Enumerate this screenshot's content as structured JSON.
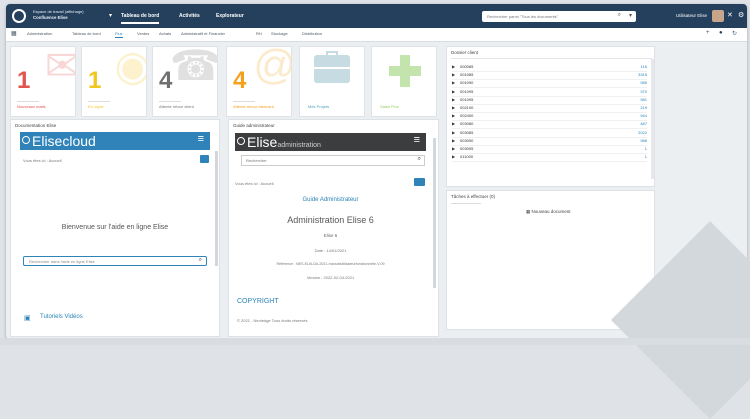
{
  "topbar": {
    "org_line1": "Espace de travail (affichage)",
    "org_line2": "Confluence Elise",
    "tabs": [
      "Tableau de bord",
      "Activités",
      "Explorateur"
    ],
    "search_placeholder": "Rechercher parmi \"Tous les documents\"",
    "user_name": "Utilisateur Elise"
  },
  "subnav": {
    "items": [
      "Administration",
      "Tableau de bord",
      "Flux",
      "Ventes",
      "Achats",
      "Administratif et Financier",
      "RH",
      "Stockage",
      "Distribution"
    ]
  },
  "tiles": [
    {
      "num": "1",
      "label": "Nouveaux mails",
      "color": "#e4524d",
      "icon": "envelope-icon"
    },
    {
      "num": "1",
      "label": "En copie",
      "color": "#f2c51f",
      "icon": "eye-icon"
    },
    {
      "num": "4",
      "label": "Attente retour client",
      "color": "#6f6f6f",
      "icon": "phone-icon"
    },
    {
      "num": "4",
      "label": "Attente retour fabricant",
      "color": "#f4a11c",
      "icon": "at-icon"
    },
    {
      "num": "",
      "label": "Mes Projets",
      "color": "#4ba4c0",
      "icon": "briefcase-icon"
    },
    {
      "num": "",
      "label": "Saisir Flux",
      "color": "#8fcd5b",
      "icon": "plus-icon"
    }
  ],
  "doc_panel": {
    "title": "Documentation Elise",
    "brand": "Elise",
    "brand_suffix": "cloud",
    "path": "Vous êtes ici : Accueil",
    "welcome": "Bienvenue sur l'aide en ligne Elise",
    "search_placeholder": "Rechercher dans l'aide en ligne Elise",
    "tutorial": "Tutoriels Vidéos"
  },
  "admin_panel": {
    "title": "Guide administrateur",
    "brand": "Elise",
    "brand_suffix": "administration",
    "search_placeholder": "Rechercher",
    "path": "Vous êtes ici : Accueil",
    "guide_link": "Guide Administrateur",
    "heading": "Administration Elise 6",
    "sub": "Elise 6",
    "date": "Date : 14/01/2021",
    "reference": "Référence : NES-ELI6-DA-2021-manuelutilisateurfonctionnelle-V-09",
    "version": "Version : 2022-02-04-2021",
    "copyright": "COPYRIGHT",
    "notice": "© 2021 - Neoledge Tous droits réservés"
  },
  "tree_panel": {
    "title": "Dossier client",
    "rows": [
      {
        "code": "000085",
        "count": "116"
      },
      {
        "code": "001085",
        "count": "3315"
      },
      {
        "code": "001090",
        "count": "985"
      },
      {
        "code": "001095",
        "count": "370"
      },
      {
        "code": "001095",
        "count": "981"
      },
      {
        "code": "002100",
        "count": "219"
      },
      {
        "code": "002400",
        "count": "944"
      },
      {
        "code": "003080",
        "count": "487"
      },
      {
        "code": "003085",
        "count": "2022"
      },
      {
        "code": "003090",
        "count": "988"
      },
      {
        "code": "003095",
        "count": "1"
      },
      {
        "code": "011000",
        "count": "1"
      }
    ]
  },
  "annotate_panel": {
    "title": "Tâches à effectuer (0)",
    "button": "Nouveau document"
  }
}
